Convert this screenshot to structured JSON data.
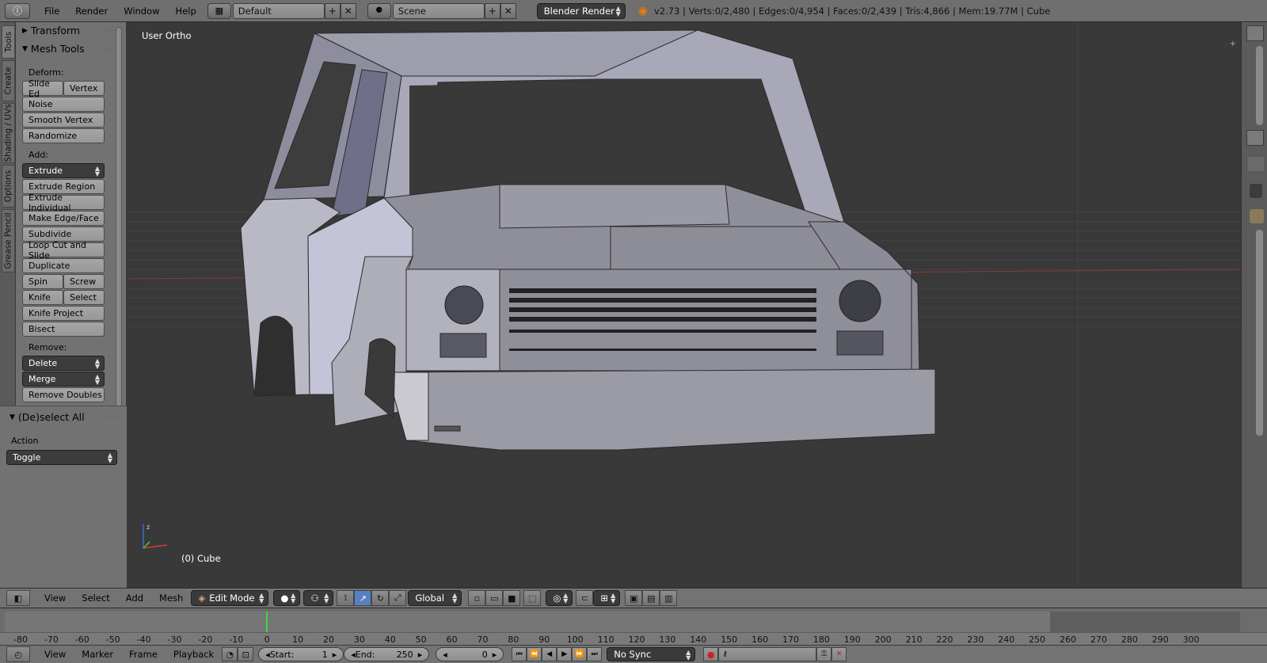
{
  "topbar": {
    "menus": [
      "File",
      "Render",
      "Window",
      "Help"
    ],
    "layout_name": "Default",
    "scene_name": "Scene",
    "engine": "Blender Render",
    "stats": "v2.73 | Verts:0/2,480 | Edges:0/4,954 | Faces:0/2,439 | Tris:4,866 | Mem:19.77M | Cube"
  },
  "vtabs": [
    "Tools",
    "Create",
    "Shading / UVs",
    "Options",
    "Grease Pencil"
  ],
  "toolshelf": {
    "transform_head": "Transform",
    "mesh_tools_head": "Mesh Tools",
    "deform_label": "Deform:",
    "slide_edge": "Slide Ed",
    "vertex": "Vertex",
    "noise": "Noise",
    "smooth_vertex": "Smooth Vertex",
    "randomize": "Randomize",
    "add_label": "Add:",
    "extrude": "Extrude",
    "extrude_region": "Extrude Region",
    "extrude_individual": "Extrude Individual",
    "make_edge_face": "Make Edge/Face",
    "subdivide": "Subdivide",
    "loop_cut": "Loop Cut and Slide",
    "duplicate": "Duplicate",
    "spin": "Spin",
    "screw": "Screw",
    "knife": "Knife",
    "select": "Select",
    "knife_project": "Knife Project",
    "bisect": "Bisect",
    "remove_label": "Remove:",
    "delete": "Delete",
    "merge": "Merge",
    "remove_doubles": "Remove Doubles",
    "deselect_head": "(De)select All",
    "action_label": "Action",
    "action_value": "Toggle"
  },
  "viewport": {
    "view_label": "User Ortho",
    "object_label": "(0) Cube"
  },
  "view_header": {
    "menus": [
      "View",
      "Select",
      "Add",
      "Mesh"
    ],
    "mode": "Edit Mode",
    "orientation": "Global"
  },
  "timeline": {
    "ticks": [
      "-80",
      "-70",
      "-60",
      "-50",
      "-40",
      "-30",
      "-20",
      "-10",
      "0",
      "10",
      "20",
      "30",
      "40",
      "50",
      "60",
      "70",
      "80",
      "90",
      "100",
      "110",
      "120",
      "130",
      "140",
      "150",
      "160",
      "170",
      "180",
      "190",
      "200",
      "210",
      "220",
      "230",
      "240",
      "250",
      "260",
      "270",
      "280",
      "290",
      "300"
    ],
    "current_frame": 0
  },
  "timeline_header": {
    "menus": [
      "View",
      "Marker",
      "Frame",
      "Playback"
    ],
    "start_label": "Start:",
    "start_value": "1",
    "end_label": "End:",
    "end_value": "250",
    "current_value": "0",
    "sync": "No Sync"
  }
}
